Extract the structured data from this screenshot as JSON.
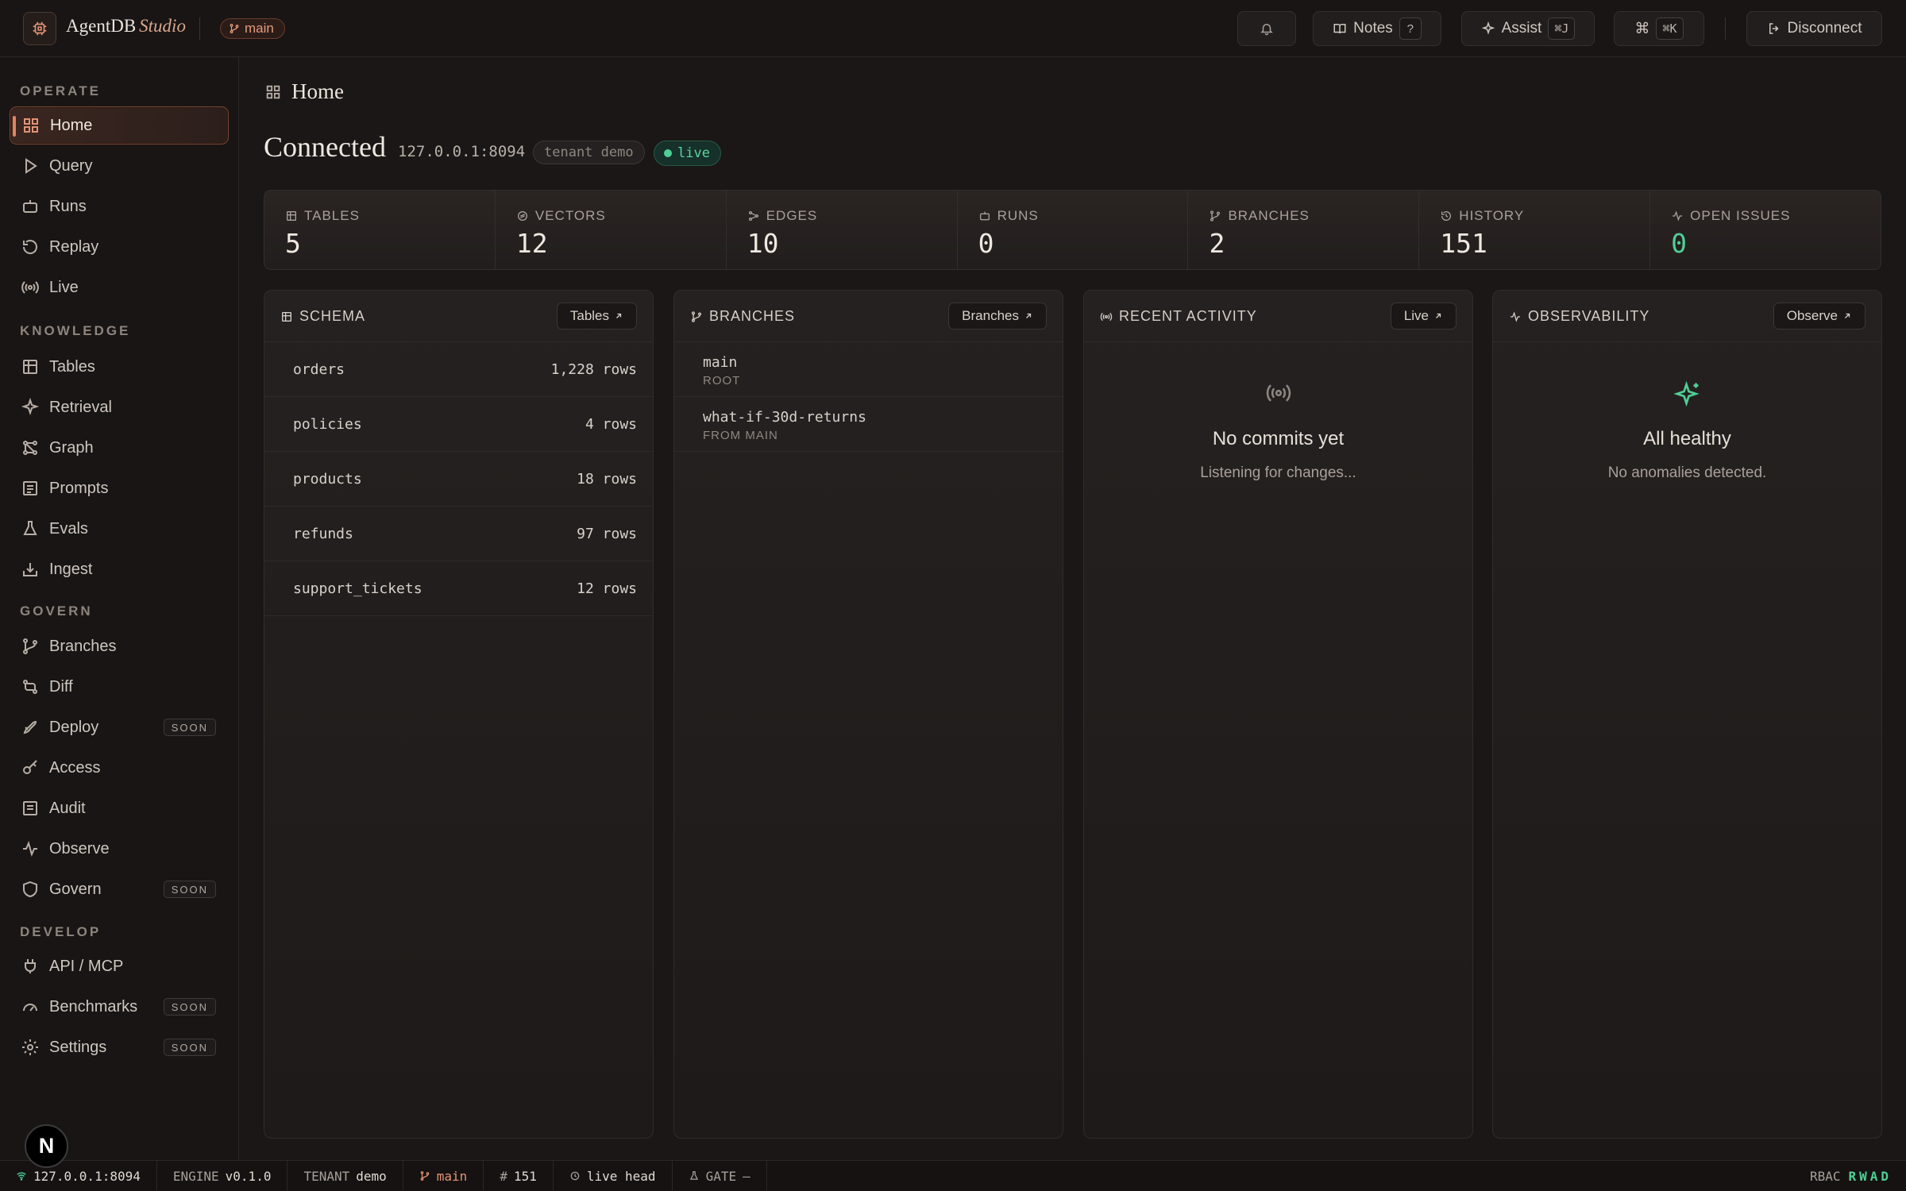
{
  "app": {
    "name": "AgentDB",
    "name_suffix": "Studio",
    "branch": "main"
  },
  "topbar": {
    "notes_label": "Notes",
    "notes_kbd": "?",
    "assist_label": "Assist",
    "assist_kbd": "⌘J",
    "cmd_symbol": "⌘",
    "cmd_kbd": "⌘K",
    "disconnect_label": "Disconnect"
  },
  "sidebar": {
    "sections": {
      "operate": "OPERATE",
      "knowledge": "KNOWLEDGE",
      "govern": "GOVERN",
      "develop": "DEVELOP"
    },
    "items": [
      {
        "label": "Home",
        "icon": "grid-icon"
      },
      {
        "label": "Query",
        "icon": "play-icon"
      },
      {
        "label": "Runs",
        "icon": "robot-icon"
      },
      {
        "label": "Replay",
        "icon": "replay-icon"
      },
      {
        "label": "Live",
        "icon": "broadcast-icon"
      },
      {
        "label": "Tables",
        "icon": "table-icon"
      },
      {
        "label": "Retrieval",
        "icon": "sparkle-icon"
      },
      {
        "label": "Graph",
        "icon": "graph-icon"
      },
      {
        "label": "Prompts",
        "icon": "prompt-icon"
      },
      {
        "label": "Evals",
        "icon": "flask-icon"
      },
      {
        "label": "Ingest",
        "icon": "download-icon"
      },
      {
        "label": "Branches",
        "icon": "branch-icon"
      },
      {
        "label": "Diff",
        "icon": "diff-icon"
      },
      {
        "label": "Deploy",
        "icon": "rocket-icon",
        "badge": "SOON"
      },
      {
        "label": "Access",
        "icon": "key-icon"
      },
      {
        "label": "Audit",
        "icon": "audit-icon"
      },
      {
        "label": "Observe",
        "icon": "pulse-icon"
      },
      {
        "label": "Govern",
        "icon": "shield-icon",
        "badge": "SOON"
      },
      {
        "label": "API / MCP",
        "icon": "plug-icon"
      },
      {
        "label": "Benchmarks",
        "icon": "gauge-icon",
        "badge": "SOON"
      },
      {
        "label": "Settings",
        "icon": "gear-icon",
        "badge": "SOON"
      }
    ],
    "n_badge": "N"
  },
  "main": {
    "breadcrumb": "Home",
    "heading": "Connected",
    "host": "127.0.0.1:8094",
    "tenant": "tenant demo",
    "status": "live",
    "stats": [
      {
        "label": "TABLES",
        "value": "5"
      },
      {
        "label": "VECTORS",
        "value": "12"
      },
      {
        "label": "EDGES",
        "value": "10"
      },
      {
        "label": "RUNS",
        "value": "0"
      },
      {
        "label": "BRANCHES",
        "value": "2"
      },
      {
        "label": "HISTORY",
        "value": "151"
      },
      {
        "label": "OPEN ISSUES",
        "value": "0"
      }
    ],
    "schema": {
      "title": "SCHEMA",
      "button": "Tables",
      "rows": [
        {
          "name": "orders",
          "count": "1,228 rows"
        },
        {
          "name": "policies",
          "count": "4 rows"
        },
        {
          "name": "products",
          "count": "18 rows"
        },
        {
          "name": "refunds",
          "count": "97 rows"
        },
        {
          "name": "support_tickets",
          "count": "12 rows"
        }
      ]
    },
    "branches": {
      "title": "BRANCHES",
      "button": "Branches",
      "rows": [
        {
          "name": "main",
          "sub": "ROOT"
        },
        {
          "name": "what-if-30d-returns",
          "sub": "FROM MAIN"
        }
      ]
    },
    "activity": {
      "title": "RECENT ACTIVITY",
      "button": "Live",
      "empty_title": "No commits yet",
      "empty_sub": "Listening for changes..."
    },
    "observability": {
      "title": "OBSERVABILITY",
      "button": "Observe",
      "empty_title": "All healthy",
      "empty_sub": "No anomalies detected."
    }
  },
  "statusbar": {
    "host": "127.0.0.1:8094",
    "engine_label": "ENGINE",
    "engine_value": "v0.1.0",
    "tenant_label": "TENANT",
    "tenant_value": "demo",
    "branch": "main",
    "commit": "151",
    "head": "live head",
    "gate_label": "GATE",
    "gate_value": "–",
    "rbac_label": "RBAC",
    "rbac_value": "RWAD"
  },
  "colors": {
    "accent": "#e08463",
    "success": "#4fcf96",
    "background": "#1a1716"
  }
}
